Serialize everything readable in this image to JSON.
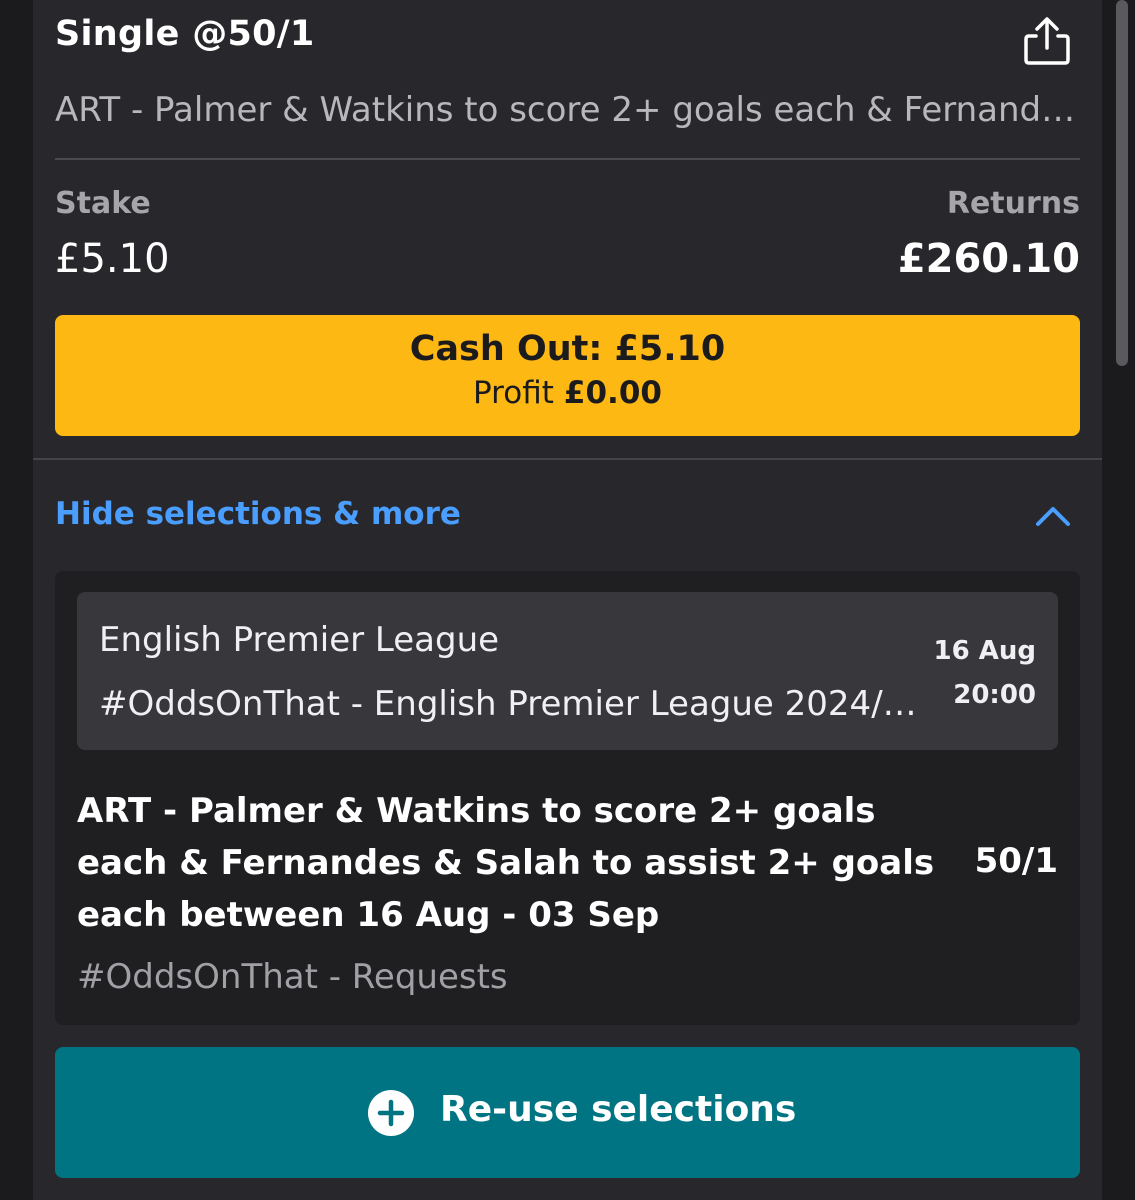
{
  "bet": {
    "title": "Single @50/1",
    "description": "ART - Palmer & Watkins to score 2+ goals each & Fernandes & Salah to assist 2+ goals each between 16 Aug - 03 Sep"
  },
  "stake": {
    "label": "Stake",
    "value": "£5.10"
  },
  "returns": {
    "label": "Returns",
    "value": "£260.10"
  },
  "cashout": {
    "label": "Cash Out: £5.10",
    "profit_label": "Profit",
    "profit_value": "£0.00",
    "color": "#fdb813"
  },
  "toggle": {
    "label": "Hide selections & more",
    "icon": "chevron-up-icon",
    "color": "#4a9eff"
  },
  "event": {
    "league": "English Premier League",
    "market_group": "#OddsOnThat - English Premier League 2024/2...",
    "date": "16 Aug",
    "time": "20:00"
  },
  "selection": {
    "text": "ART - Palmer & Watkins to score 2+ goals each & Fernandes & Salah to assist 2+ goals each between 16 Aug - 03 Sep",
    "odds": "50/1",
    "market": "#OddsOnThat - Requests"
  },
  "reuse": {
    "label": "Re-use selections",
    "icon": "plus-circle-icon",
    "color": "#007482"
  },
  "header_icons": {
    "share": "share-icon"
  }
}
